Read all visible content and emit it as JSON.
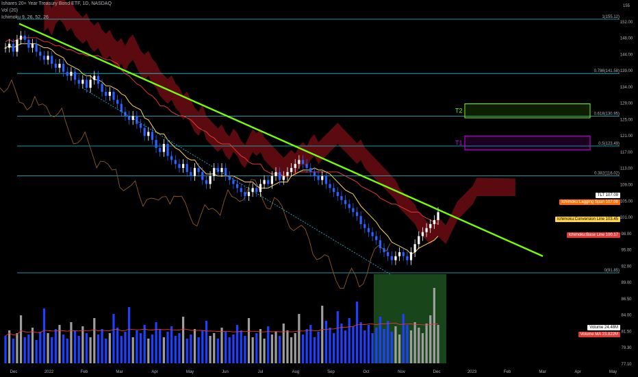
{
  "header": {
    "symbol_line": "Ishares 20+ Year Treasury Bond ETF, 1D, NASDAQ",
    "vol_line": "Vol (20)",
    "ichimoku_line": "Ichimoku 9, 26, 52, 26"
  },
  "colors": {
    "background": "#000000",
    "fib_line": "#26c6da",
    "trendline": "#76ff03",
    "up_candle": "#ffffff",
    "down_candle": "#2962ff",
    "conversion_line": "#ffd54f",
    "base_line": "#e53935",
    "lagging_span": "#8d5a2b",
    "cloud_bearish": "#7a0f14",
    "cloud_bullish": "#3d4a20",
    "t2_box": "#76ff03",
    "t1_box": "#d500f9",
    "volume_highlight": "#2e7d32"
  },
  "chart_data": {
    "type": "candlestick",
    "title": "Ishares 20+ Year Treasury Bond ETF, 1D, NASDAQ",
    "price_axis": {
      "ticks": [
        "155",
        "152.00",
        "148.00",
        "144.00",
        "139.00",
        "134.00",
        "129.00",
        "125.00",
        "121.00",
        "117.00",
        "113.00",
        "109.00",
        "105.00",
        "101.00",
        "98.00",
        "95.00",
        "92.00",
        "89.00",
        "86.50",
        "84.00",
        "81.50",
        "79.30",
        "77.10"
      ]
    },
    "time_axis": {
      "ticks": [
        "Dec",
        "2022",
        "Feb",
        "Mar",
        "Apr",
        "May",
        "Jun",
        "Jul",
        "Aug",
        "Sep",
        "Oct",
        "Nov",
        "Dec",
        "2023",
        "Feb",
        "Mar",
        "Apr",
        "May"
      ]
    },
    "fib_levels": [
      {
        "label": "1(155.12)",
        "price": 155.12
      },
      {
        "label": "0.786(141.58)",
        "price": 141.58
      },
      {
        "label": "0.618(130.95)",
        "price": 130.95
      },
      {
        "label": "0.5(123.49)",
        "price": 123.49
      },
      {
        "label": "0.382(116.02)",
        "price": 116.02
      },
      {
        "label": "0(91.85)",
        "price": 91.85
      }
    ],
    "targets": [
      {
        "label": "T2",
        "price_low": 130.5,
        "price_high": 134.0
      },
      {
        "label": "T1",
        "price_low": 122.5,
        "price_high": 126.0
      }
    ],
    "price_labels": [
      {
        "name": "TLT",
        "value": "107.09",
        "color": "#ffffff",
        "text_color": "#000000"
      },
      {
        "name": "Ichimoku:Lagging Span",
        "value": "107.09",
        "color": "#ff6d00",
        "text_color": "#ffffff"
      },
      {
        "name": "Ichimoku:Conversion Line",
        "value": "103.45",
        "color": "#ffd54f",
        "text_color": "#000000"
      },
      {
        "name": "Ichimoku:Base Line",
        "value": "100.17",
        "color": "#e53935",
        "text_color": "#ffffff"
      },
      {
        "name": "Volume",
        "value": "24.48M",
        "color": "#ffffff",
        "text_color": "#000000"
      },
      {
        "name": "Volume MA",
        "value": "23.822M",
        "color": "#e53935",
        "text_color": "#ffffff"
      }
    ],
    "close_series": [
      148,
      149,
      147,
      150,
      151,
      150,
      148,
      149,
      147,
      146,
      145,
      146,
      144,
      143,
      144,
      142,
      141,
      142,
      140,
      139,
      140,
      138,
      140,
      141,
      139,
      137,
      136,
      137,
      135,
      134,
      132,
      131,
      130,
      131,
      129,
      128,
      126,
      127,
      125,
      123,
      122,
      124,
      121,
      120,
      119,
      118,
      119,
      117,
      116,
      118,
      117,
      115,
      114,
      116,
      118,
      117,
      118,
      116,
      115,
      114,
      113,
      112,
      111,
      112,
      113,
      112,
      114,
      115,
      114,
      116,
      117,
      115,
      116,
      117,
      118,
      119,
      120,
      119,
      118,
      117,
      116,
      115,
      116,
      114,
      113,
      112,
      111,
      110,
      109,
      108,
      107,
      106,
      104,
      103,
      102,
      101,
      100,
      98,
      97,
      96,
      95,
      96,
      97,
      96,
      95,
      97,
      99,
      101,
      102,
      103,
      104,
      105,
      107
    ],
    "volume_series": [
      20,
      24,
      18,
      22,
      35,
      19,
      21,
      26,
      17,
      23,
      40,
      22,
      19,
      25,
      28,
      21,
      18,
      30,
      24,
      20,
      27,
      22,
      19,
      33,
      21,
      25,
      18,
      22,
      36,
      26,
      20,
      23,
      41,
      19,
      24,
      22,
      28,
      18,
      21,
      30,
      25,
      19,
      23,
      27,
      20,
      22,
      34,
      18,
      21,
      25,
      19,
      24,
      31,
      20,
      22,
      18,
      26,
      23,
      19,
      21,
      28,
      24,
      20,
      33,
      19,
      22,
      25,
      18,
      27,
      21,
      23,
      20,
      29,
      24,
      19,
      22,
      36,
      21,
      25,
      28,
      19,
      23,
      42,
      31,
      26,
      22,
      38,
      29,
      24,
      33,
      27,
      45,
      30,
      24,
      28,
      22,
      26,
      34,
      25,
      31,
      23,
      27,
      21,
      36,
      28,
      24,
      30,
      26,
      22,
      29,
      35,
      55,
      28
    ]
  }
}
